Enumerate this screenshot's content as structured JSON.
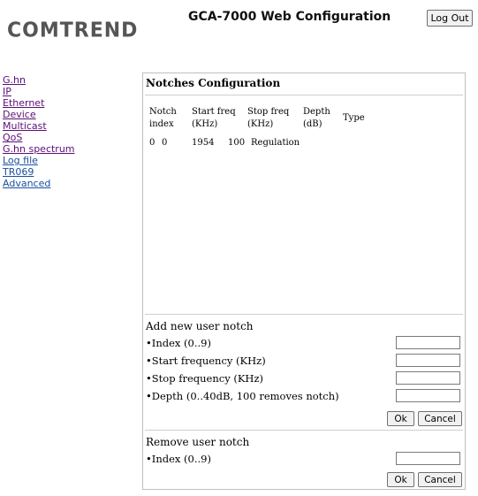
{
  "header": {
    "logo_text": "COMTREND",
    "title": "GCA-7000 Web Configuration",
    "logout_label": "Log Out"
  },
  "nav": {
    "items": [
      {
        "label": "G.hn"
      },
      {
        "label": "IP"
      },
      {
        "label": "Ethernet"
      },
      {
        "label": "Device"
      },
      {
        "label": "Multicast"
      },
      {
        "label": "QoS"
      },
      {
        "label": "G.hn spectrum"
      },
      {
        "label": "Log file"
      },
      {
        "label": "TR069"
      },
      {
        "label": "Advanced"
      }
    ]
  },
  "panel": {
    "title": "Notches Configuration",
    "table": {
      "headers": [
        {
          "line1": "Notch",
          "line2": "index"
        },
        {
          "line1": "Start freq",
          "line2": "(KHz)"
        },
        {
          "line1": "Stop freq",
          "line2": "(KHz)"
        },
        {
          "line1": "Depth",
          "line2": "(dB)"
        },
        {
          "line1": "Type",
          "line2": ""
        }
      ],
      "rows": [
        [
          "0",
          "0",
          "1954",
          "100",
          "Regulation"
        ]
      ]
    },
    "add": {
      "title": "Add new user notch",
      "index_label": "•Index (0..9)",
      "start_label": "•Start frequency (KHz)",
      "stop_label": "•Stop frequency (KHz)",
      "depth_label": "•Depth (0..40dB, 100 removes notch)",
      "index_value": "",
      "start_value": "",
      "stop_value": "",
      "depth_value": "",
      "ok_label": "Ok",
      "cancel_label": "Cancel"
    },
    "remove": {
      "title": "Remove user notch",
      "index_label": "•Index (0..9)",
      "index_value": "",
      "ok_label": "Ok",
      "cancel_label": "Cancel"
    }
  }
}
